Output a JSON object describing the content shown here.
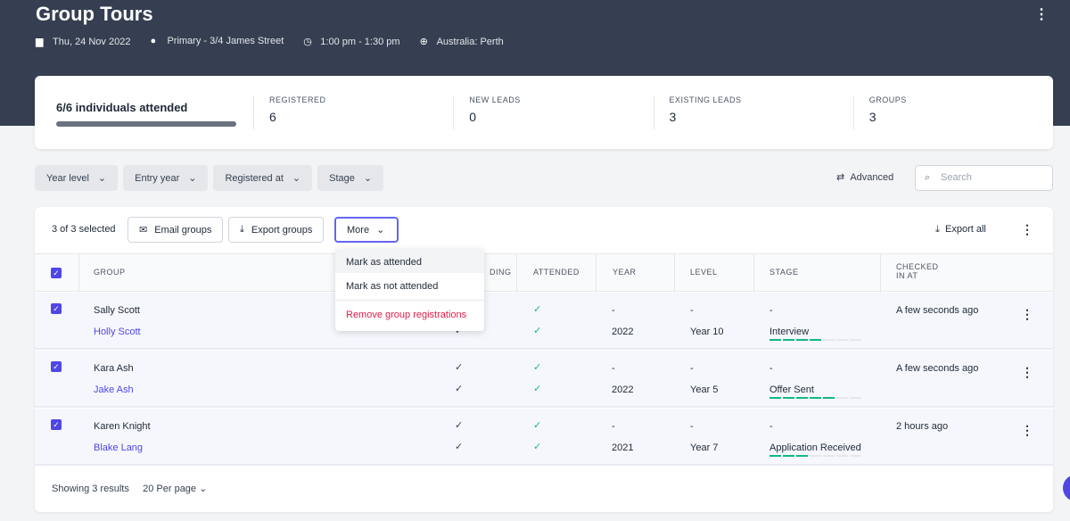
{
  "header": {
    "title": "Group Tours",
    "date": "Thu, 24 Nov 2022",
    "location": "Primary - 3/4 James Street",
    "time": "1:00 pm  - 1:30 pm",
    "timezone": "Australia: Perth"
  },
  "stats": {
    "attended_label": "6/6 individuals attended",
    "attended_fraction": 1.0,
    "items": [
      {
        "label": "REGISTERED",
        "value": "6"
      },
      {
        "label": "NEW LEADS",
        "value": "0"
      },
      {
        "label": "EXISTING LEADS",
        "value": "3"
      },
      {
        "label": "GROUPS",
        "value": "3"
      }
    ]
  },
  "filters": [
    "Year level",
    "Entry year",
    "Registered at",
    "Stage"
  ],
  "advanced": "Advanced",
  "search_placeholder": "Search",
  "toolbar": {
    "selected": "3 of 3 selected",
    "email": "Email groups",
    "export": "Export groups",
    "more": "More",
    "export_all": "Export all"
  },
  "columns": [
    "GROUP",
    "DING",
    "ATTENDED",
    "YEAR",
    "LEVEL",
    "STAGE",
    "CHECKED",
    "IN AT"
  ],
  "rows": [
    {
      "g1": "Sally Scott",
      "g2": "Holly Scott",
      "year1": "-",
      "year2": "2022",
      "level1": "-",
      "level2": "Year 10",
      "stage1": "-",
      "stage2": "Interview",
      "progress": 4,
      "checked": "A few seconds ago"
    },
    {
      "g1": "Kara Ash",
      "g2": "Jake Ash",
      "year1": "-",
      "year2": "2022",
      "level1": "-",
      "level2": "Year 5",
      "stage1": "-",
      "stage2": "Offer Sent",
      "progress": 5,
      "checked": "A few seconds ago"
    },
    {
      "g1": "Karen Knight",
      "g2": "Blake Lang",
      "year1": "-",
      "year2": "2021",
      "level1": "-",
      "level2": "Year 7",
      "stage1": "-",
      "stage2": "Application Received",
      "progress": 3,
      "checked": "2 hours ago"
    }
  ],
  "footer": {
    "results": "Showing 3 results",
    "per_page": "20 Per page"
  },
  "menu": {
    "items": [
      "Mark as attended",
      "Mark as not attended"
    ],
    "danger": "Remove group registrations"
  },
  "colors": {
    "accent": "#4f46e5",
    "success": "#10b981",
    "danger": "#e11d48",
    "header": "#353f51"
  }
}
